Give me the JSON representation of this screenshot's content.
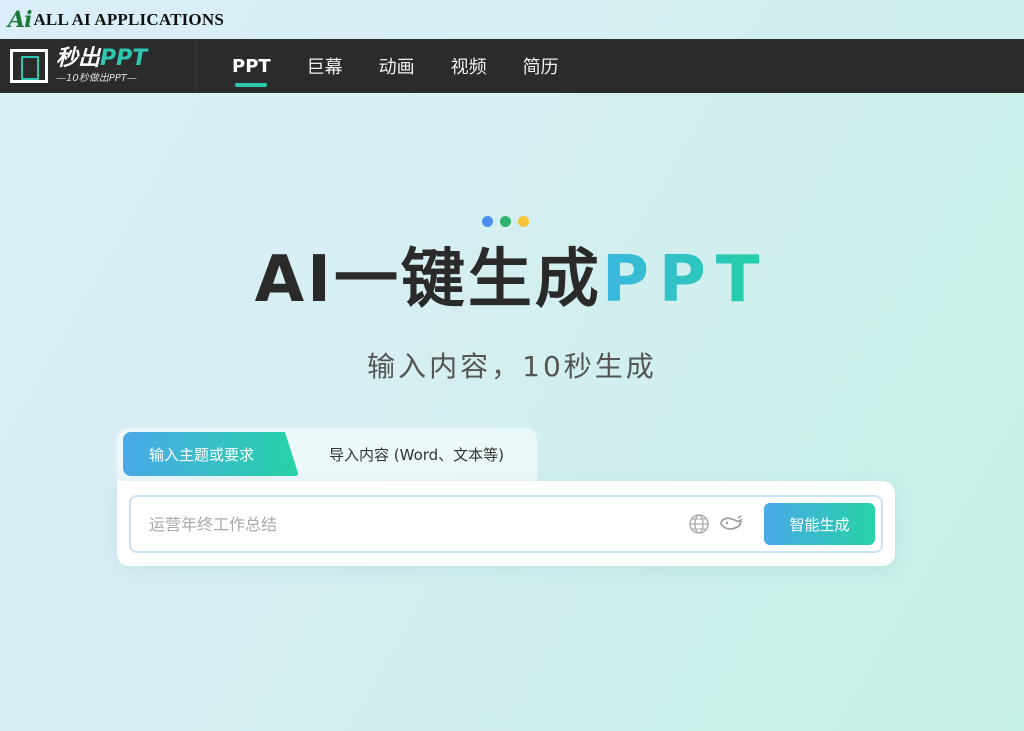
{
  "watermark": {
    "mark": "Ai",
    "text": "ALL AI APPLICATIONS"
  },
  "logo": {
    "title_main": "秒出",
    "title_accent": "PPT",
    "subtitle": "—10秒做出PPT—"
  },
  "nav": {
    "items": [
      {
        "label": "PPT",
        "active": true
      },
      {
        "label": "巨幕",
        "active": false
      },
      {
        "label": "动画",
        "active": false
      },
      {
        "label": "视频",
        "active": false
      },
      {
        "label": "简历",
        "active": false
      }
    ]
  },
  "hero": {
    "dot_colors": [
      "#4a8ff0",
      "#2fb36a",
      "#f5c23a"
    ],
    "title_main": "AI一键生成",
    "title_accent": "PPT",
    "subtitle": "输入内容，10秒生成"
  },
  "tabs": {
    "active_label": "输入主题或要求",
    "other_label": "导入内容 (Word、文本等)"
  },
  "input": {
    "value": "",
    "placeholder": "运营年终工作总结",
    "globe_icon": "globe-icon",
    "model_icon": "whale-icon",
    "generate_label": "智能生成"
  },
  "colors": {
    "accent_start": "#4aa9e8",
    "accent_end": "#26d3a6",
    "nav_bg": "#2b2b2b"
  }
}
